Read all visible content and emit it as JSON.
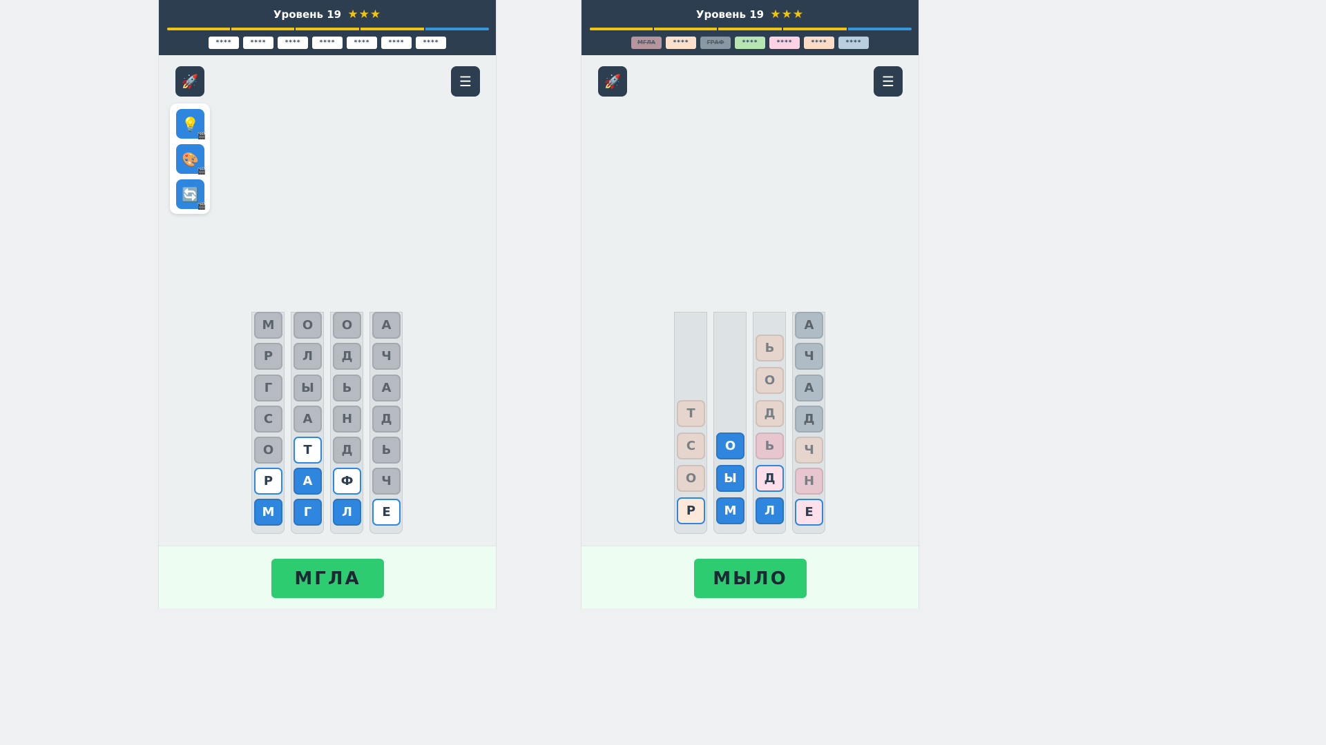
{
  "accent": "#2e86de",
  "header_bg": "#2c3e50",
  "left": {
    "level_label": "Уровень",
    "level_number": "19",
    "stars": "★★★",
    "progress_fraction": 0.8,
    "words": [
      {
        "text": "****"
      },
      {
        "text": "****"
      },
      {
        "text": "****"
      },
      {
        "text": "****"
      },
      {
        "text": "****"
      },
      {
        "text": "****"
      },
      {
        "text": "****"
      }
    ],
    "rocket_icon": "🚀",
    "menu_icon": "☰",
    "tools": [
      {
        "icon": "💡",
        "name": "hint-bulb-icon",
        "clap": "🎬"
      },
      {
        "icon": "🎨",
        "name": "palette-icon",
        "clap": "🎬"
      },
      {
        "icon": "🔄",
        "name": "shuffle-icon",
        "clap": "🎬"
      }
    ],
    "current_word": "МГЛА",
    "columns": [
      [
        "М",
        "Р",
        "Г",
        "С",
        "О",
        "Р",
        "М"
      ],
      [
        "О",
        "Л",
        "Ы",
        "А",
        "Т",
        "А",
        "Г"
      ],
      [
        "О",
        "Д",
        "Ь",
        "Н",
        "Д",
        "Ф",
        "Л"
      ],
      [
        "А",
        "Ч",
        "А",
        "Д",
        "Ь",
        "Ч",
        "Е"
      ]
    ]
  },
  "right": {
    "level_label": "Уровень",
    "level_number": "19",
    "stars": "★★★",
    "progress_fraction": 0.8,
    "words": [
      {
        "text": "МГЛА",
        "done": true,
        "color": "#b5969f"
      },
      {
        "text": "****",
        "color": "#fde0cc"
      },
      {
        "text": "ГРАФ",
        "done": true,
        "color": "#8a98a4"
      },
      {
        "text": "****",
        "color": "#b7e6b3"
      },
      {
        "text": "****",
        "color": "#fbd3e2"
      },
      {
        "text": "****",
        "color": "#fcdcc6"
      },
      {
        "text": "****",
        "color": "#b9cfe0"
      }
    ],
    "rocket_icon": "🚀",
    "menu_icon": "☰",
    "current_word": "МЫЛО",
    "columns": [
      [
        "Т",
        "С",
        "О",
        "Р"
      ],
      [
        "О",
        "Ы",
        "М"
      ],
      [
        "Ь",
        "О",
        "Д",
        "Ь",
        "Д",
        "Л"
      ],
      [
        "А",
        "Ч",
        "А",
        "Д",
        "Ч",
        "Н",
        "Е"
      ]
    ]
  }
}
